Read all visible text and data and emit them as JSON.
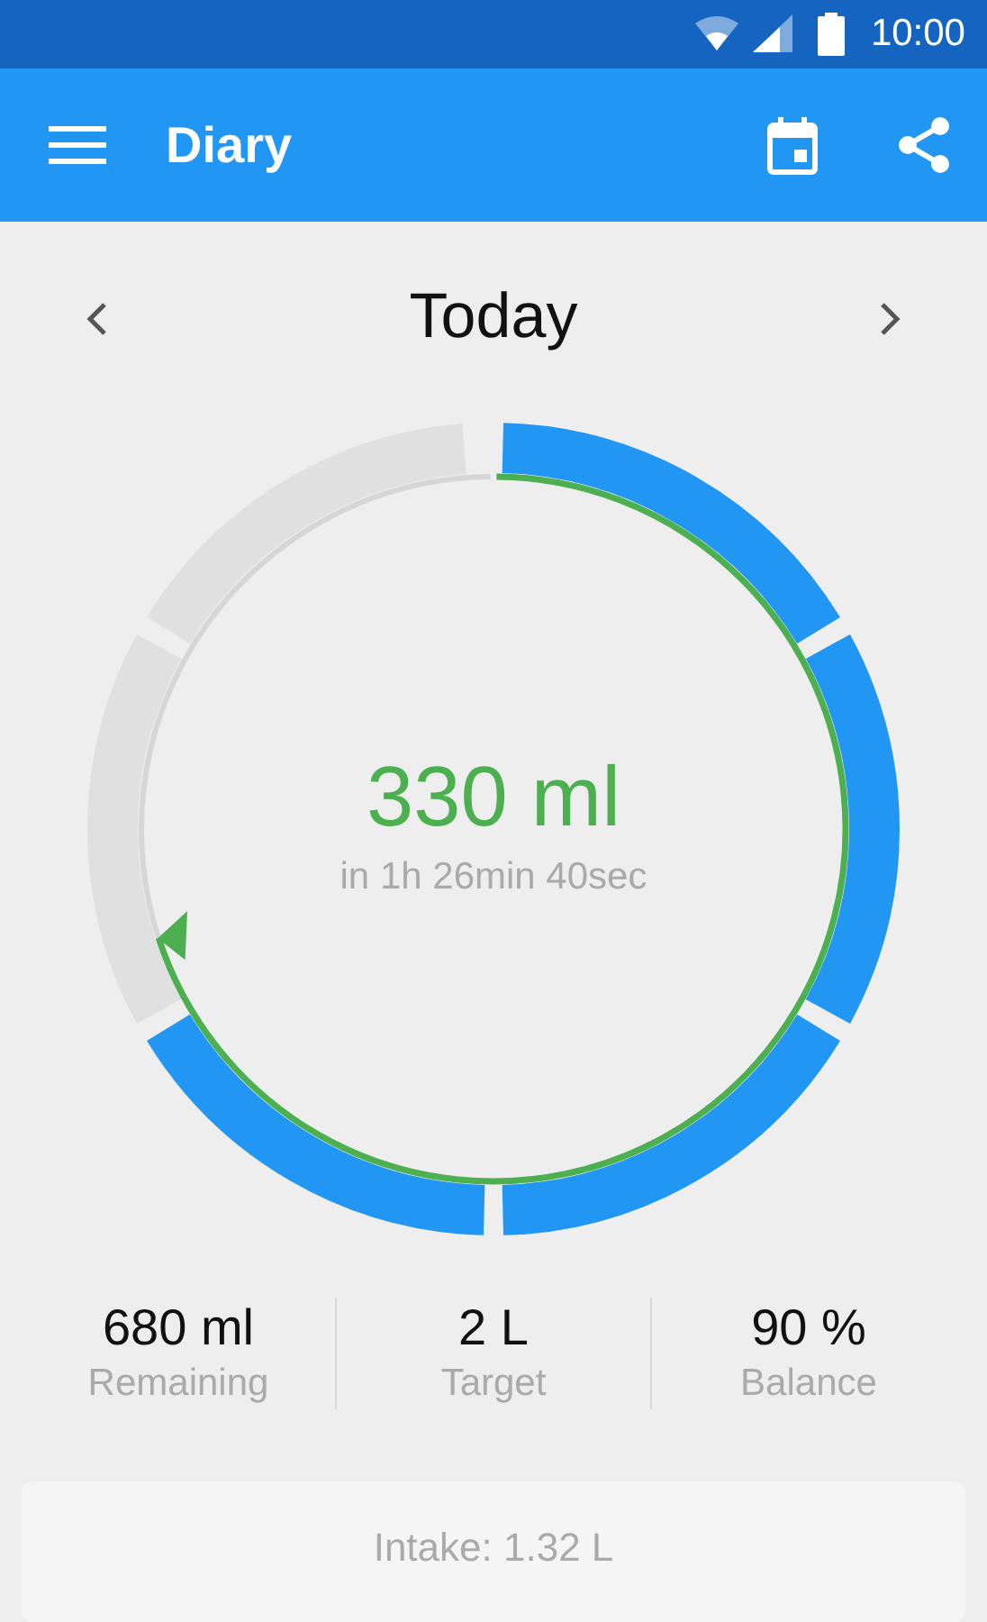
{
  "status_bar": {
    "time": "10:00"
  },
  "app_bar": {
    "title": "Diary"
  },
  "date_nav": {
    "label": "Today"
  },
  "ring": {
    "amount": "330 ml",
    "countdown": "in 1h 26min 40sec",
    "segments": [
      {
        "filled": true
      },
      {
        "filled": true
      },
      {
        "filled": true
      },
      {
        "filled": true
      },
      {
        "filled": false
      },
      {
        "filled": false
      }
    ]
  },
  "stats": [
    {
      "value": "680 ml",
      "label": "Remaining"
    },
    {
      "value": "2 L",
      "label": "Target"
    },
    {
      "value": "90 %",
      "label": "Balance"
    }
  ],
  "intake_card": {
    "text": "Intake: 1.32 L"
  }
}
